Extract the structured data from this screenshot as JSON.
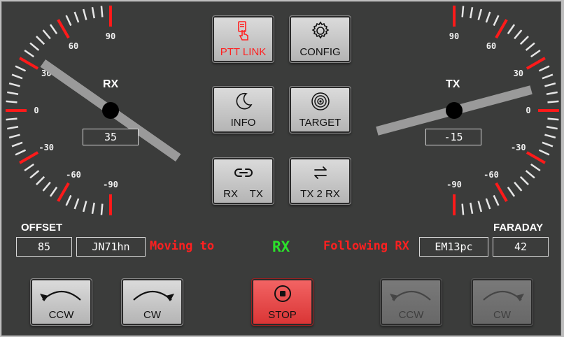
{
  "gauges": {
    "rx": {
      "label": "RX",
      "value_text": "35",
      "angle_deg": 35,
      "tick_labels": [
        "90",
        "60",
        "30",
        "0",
        "-30",
        "-60",
        "-90"
      ]
    },
    "tx": {
      "label": "TX",
      "value_text": "-15",
      "angle_deg": -15,
      "tick_labels": [
        "-90",
        "-60",
        "-30",
        "0",
        "30",
        "60",
        "90"
      ]
    }
  },
  "buttons": {
    "ptt_link": {
      "label": "PTT LINK",
      "icon": "hand-pointer-icon"
    },
    "config": {
      "label": "CONFIG",
      "icon": "gear-icon"
    },
    "info": {
      "label": "INFO",
      "icon": "moon-icon"
    },
    "target": {
      "label": "TARGET",
      "icon": "target-icon"
    },
    "rx_tx": {
      "label_left": "RX",
      "label_right": "TX",
      "icon": "link-icon"
    },
    "tx2rx": {
      "label": "TX 2 RX",
      "icon": "swap-arrows-icon"
    },
    "stop": {
      "label": "STOP",
      "icon": "stop-circle-icon"
    },
    "rx_ccw": {
      "label": "CCW",
      "icon": "rotate-ccw-icon"
    },
    "rx_cw": {
      "label": "CW",
      "icon": "rotate-cw-icon"
    },
    "tx_ccw": {
      "label": "CCW",
      "icon": "rotate-ccw-icon"
    },
    "tx_cw": {
      "label": "CW",
      "icon": "rotate-cw-icon"
    }
  },
  "offset": {
    "label": "OFFSET",
    "value": "85"
  },
  "rx_locator": "JN71hn",
  "moving_text": "Moving to",
  "mode_text": "RX",
  "following_text": "Following RX",
  "tx_locator": "EM13pc",
  "faraday": {
    "label": "FARADAY",
    "value": "42"
  },
  "colors": {
    "panel": "#3b3c3b",
    "tick_major": "#ff1a1a",
    "tick_minor": "#e6e6e6",
    "pointer": "#9a9a9a",
    "status_red": "#ff2020",
    "mode_green": "#2be02b",
    "stop_red": "#e84545"
  }
}
